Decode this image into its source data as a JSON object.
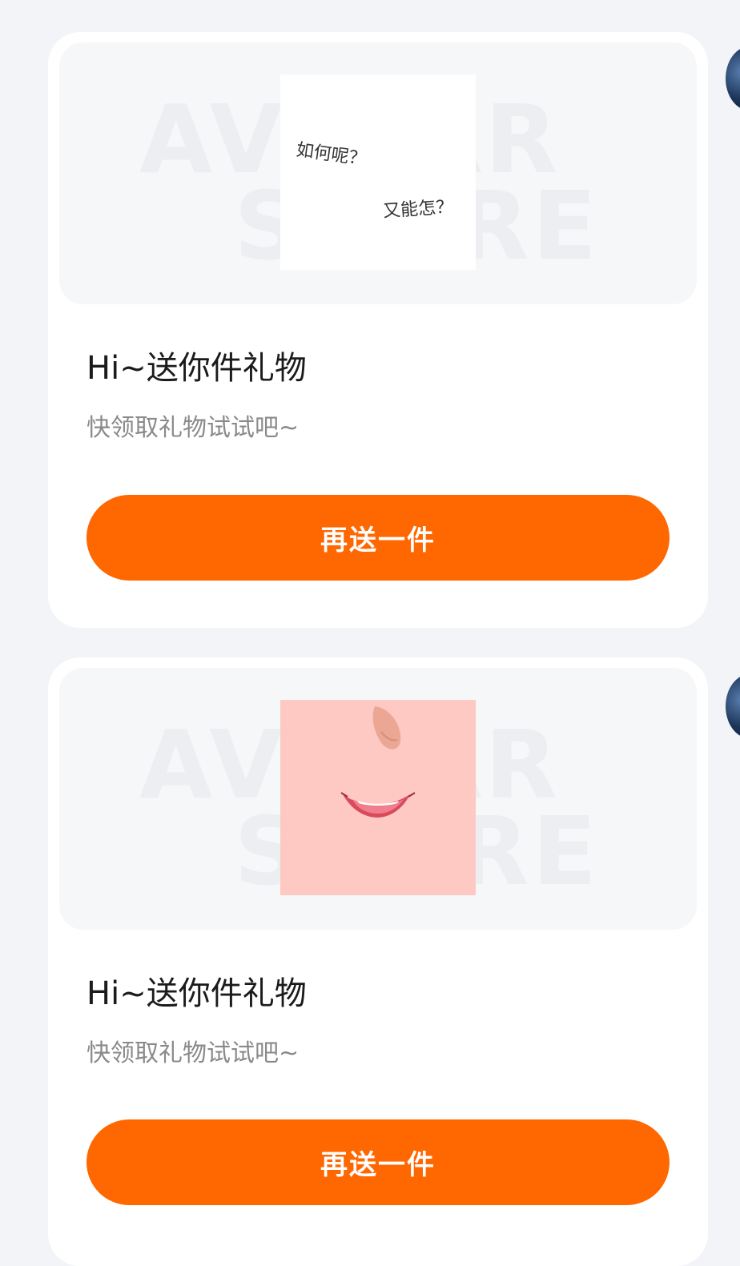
{
  "gifts": [
    {
      "image": {
        "type": "text-note",
        "lines": [
          "如何呢？",
          "又能怎？"
        ]
      },
      "watermark": {
        "line1": "AVATAR",
        "line2": "STORE"
      },
      "title": "Hi~送你件礼物",
      "subtitle": "快领取礼物试试吧~",
      "button_label": "再送一件"
    },
    {
      "image": {
        "type": "face-closeup"
      },
      "watermark": {
        "line1": "AVATAR",
        "line2": "STORE"
      },
      "title": "Hi~送你件礼物",
      "subtitle": "快领取礼物试试吧~",
      "button_label": "再送一件"
    }
  ],
  "colors": {
    "page_background": "#f2f4f7",
    "card_background": "#ffffff",
    "button": "#ff6700",
    "button_text": "#ffffff",
    "title": "#1b1b1b",
    "subtitle": "#8a8a8a"
  }
}
